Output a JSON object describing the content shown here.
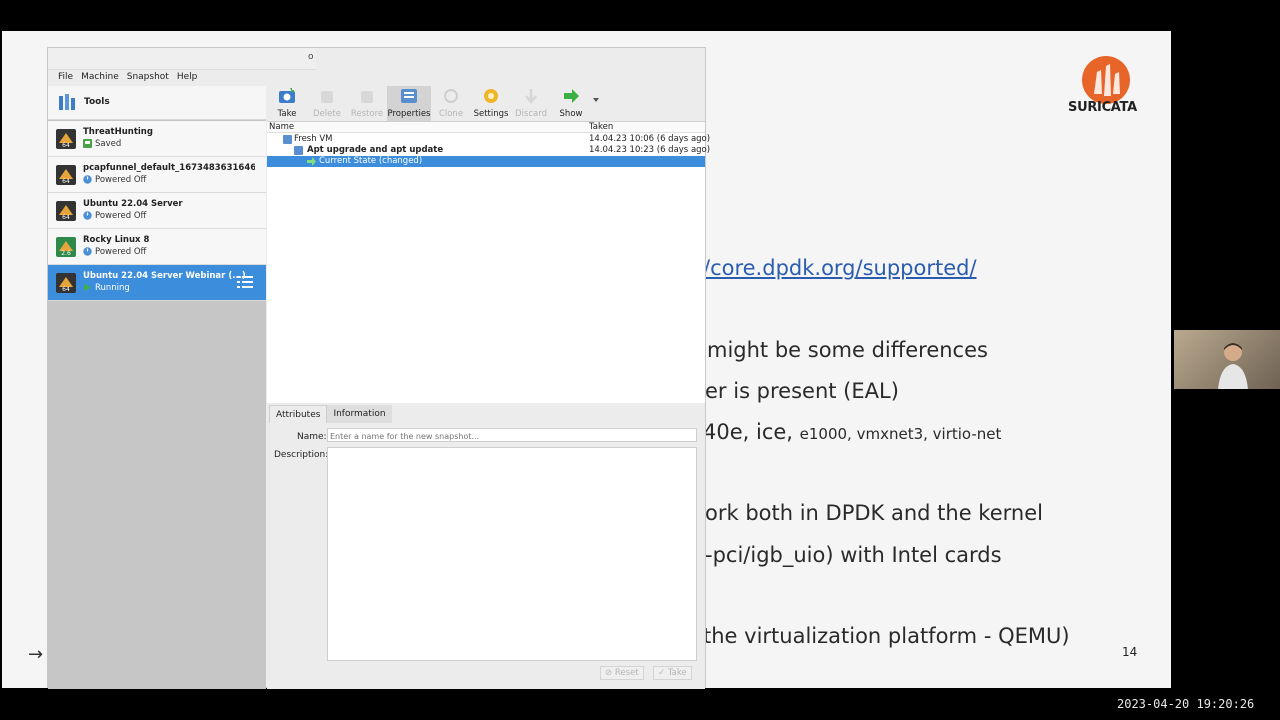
{
  "slide": {
    "link_text": "/core.dpdk.org/supported/",
    "line1": "might be some differences",
    "line2": "er is present (EAL)",
    "line3_main": "40e, ice,",
    "line3_small": "e1000, vmxnet3, virtio-net",
    "line4": "ork both in DPDK and the kernel",
    "line5": "-pci/igb_uio) with Intel cards",
    "line6": "the virtualization platform - QEMU)",
    "logo_text": "SURICATA",
    "page_number": "14",
    "arrow": "→"
  },
  "timestamp": "2023-04-20 19:20:26",
  "vbox": {
    "title_glyph": "o",
    "menu": [
      "File",
      "Machine",
      "Snapshot",
      "Help"
    ],
    "tools_label": "Tools",
    "vms": [
      {
        "name": "ThreatHunting",
        "state": "Saved",
        "state_color": "#4aa14a"
      },
      {
        "name": "pcapfunnel_default_1673483631646_...",
        "state": "Powered Off",
        "state_color": "#4a8fd6"
      },
      {
        "name": "Ubuntu 22.04 Server",
        "state": "Powered Off",
        "state_color": "#4a8fd6"
      },
      {
        "name": "Rocky Linux 8",
        "state": "Powered Off",
        "state_color": "#4a8fd6"
      },
      {
        "name": "Ubuntu 22.04 Server Webinar (...)",
        "state": "Running",
        "state_color": "#3cb043"
      }
    ],
    "toolbar": {
      "take": "Take",
      "delete": "Delete",
      "restore": "Restore",
      "properties": "Properties",
      "clone": "Clone",
      "settings": "Settings",
      "discard": "Discard",
      "show": "Show"
    },
    "tree": {
      "col_name": "Name",
      "col_taken": "Taken",
      "rows": [
        {
          "name": "Fresh VM",
          "taken": "14.04.23 10:06 (6 days ago)"
        },
        {
          "name": "Apt upgrade and apt update",
          "taken": "14.04.23 10:23 (6 days ago)"
        },
        {
          "name": "Current State (changed)",
          "taken": ""
        }
      ]
    },
    "details": {
      "tab_attributes": "Attributes",
      "tab_information": "Information",
      "name_label": "Name:",
      "name_placeholder": "Enter a name for the new snapshot...",
      "description_label": "Description:",
      "reset_label": "Reset",
      "take_label": "Take"
    }
  },
  "colors": {
    "selection": "#3c8ddc",
    "link": "#2a5db0",
    "suricata_orange": "#e8652a"
  }
}
